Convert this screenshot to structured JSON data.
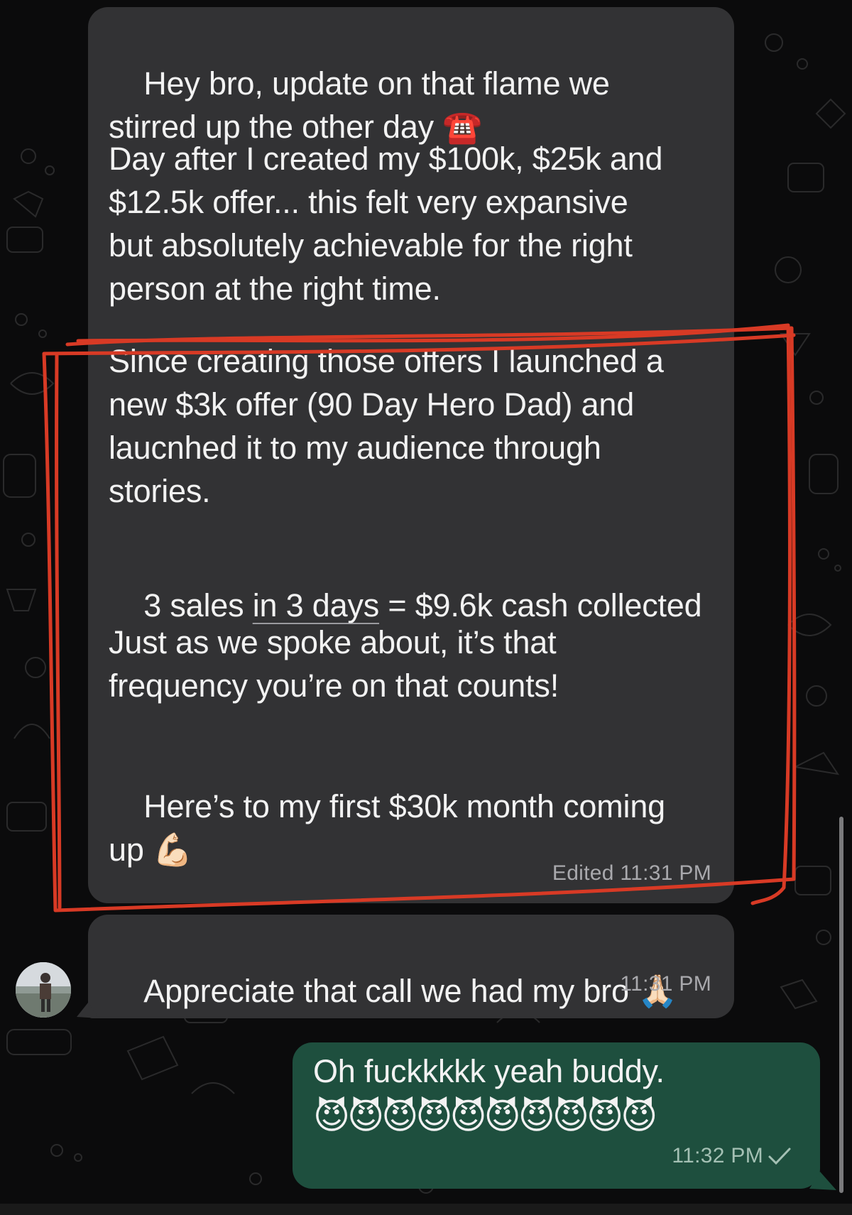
{
  "chat": {
    "messages": [
      {
        "direction": "incoming",
        "paragraphs": [
          "Hey bro, update on that flame we\nstirred up the other day ",
          "Day after I created my $100k, $25k and\n$12.5k offer... this felt very expansive\nbut absolutely achievable for the right\nperson at the right time.",
          "Since creating those offers I launched a\nnew $3k offer (90 Day Hero Dad) and\nlaucnhed it to my audience through\nstories.",
          "3 sales ",
          "in 3 days",
          " = $9.6k cash collected",
          "Just as we spoke about, it’s that\nfrequency you’re on that counts!",
          "Here’s to my first $30k month coming\nup "
        ],
        "emoji_phone": "☎️",
        "emoji_muscle": "💪🏻",
        "edited_label": "Edited",
        "time": "11:31 PM"
      },
      {
        "direction": "incoming",
        "text": "Appreciate that call we had my bro ",
        "emoji": "🙏🏻",
        "time": "11:31 PM"
      },
      {
        "direction": "outgoing",
        "text": "Oh fuckkkkk yeah buddy.",
        "emoji_row": "😈😈😈😈😈😈😈😈😈😈",
        "time": "11:32 PM",
        "status_icon": "single-check-icon"
      }
    ]
  },
  "colors": {
    "background": "#0b0b0c",
    "incoming_bubble": "#323234",
    "outgoing_bubble": "#1e4f3e",
    "annotation_red": "#d83a25"
  }
}
